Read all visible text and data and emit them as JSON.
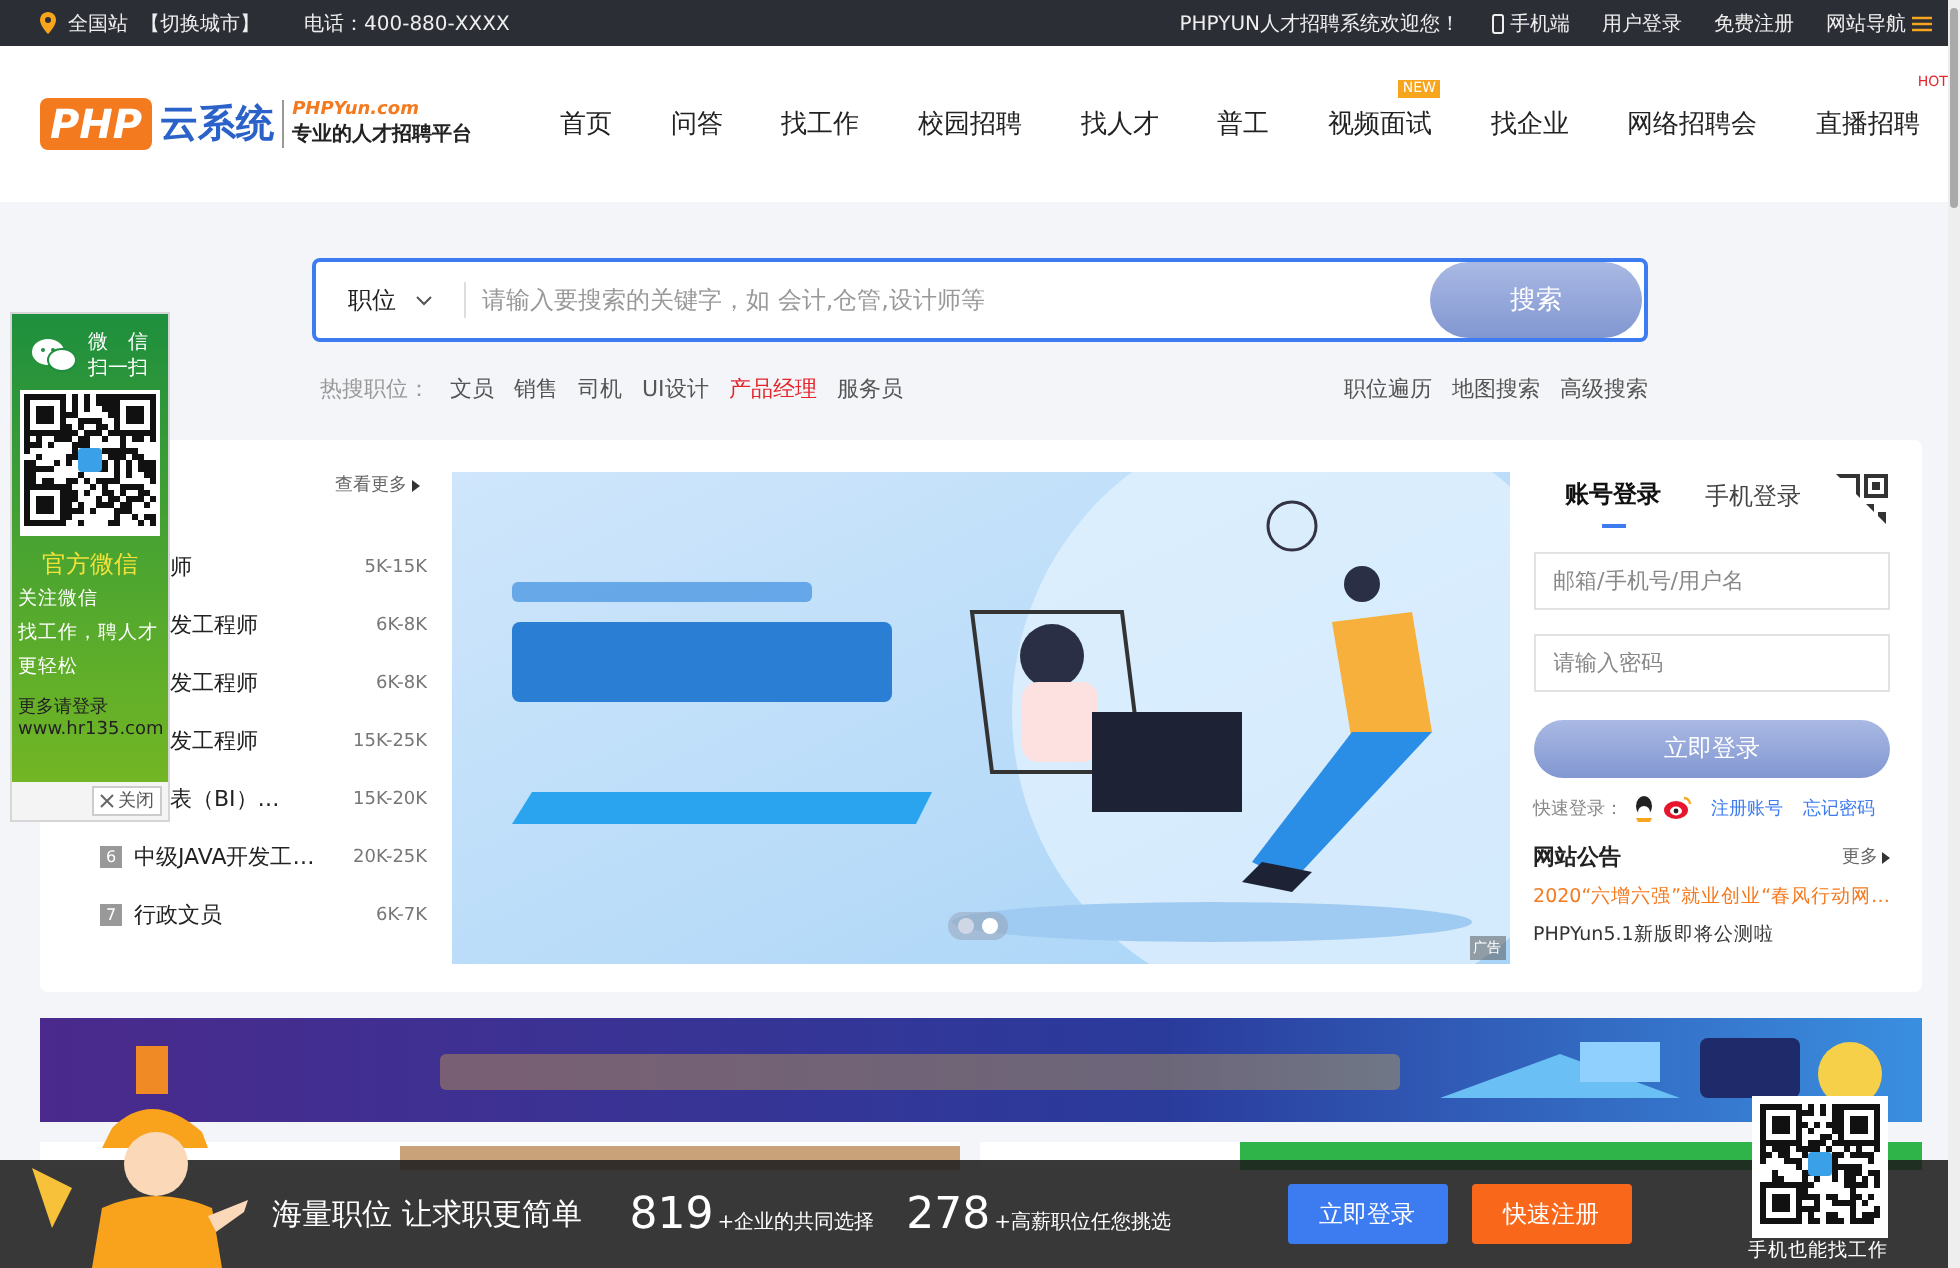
{
  "top_bar": {
    "location": "全国站",
    "switch_city": "【切换城市】",
    "phone": "电话：400-880-XXXX",
    "welcome": "PHPYUN人才招聘系统欢迎您！",
    "links": [
      {
        "label": "手机端",
        "kind": "mobile"
      },
      {
        "label": "用户登录",
        "kind": "plain"
      },
      {
        "label": "免费注册",
        "kind": "plain"
      },
      {
        "label": "网站导航",
        "kind": "menu"
      }
    ]
  },
  "logo": {
    "mark": "PHP",
    "name": "云系统",
    "domain": "PHPYun.com",
    "slogan": "专业的人才招聘平台"
  },
  "nav": [
    {
      "label": "首页"
    },
    {
      "label": "问答"
    },
    {
      "label": "找工作"
    },
    {
      "label": "校园招聘"
    },
    {
      "label": "找人才"
    },
    {
      "label": "普工"
    },
    {
      "label": "视频面试",
      "badge": "NEW",
      "kind": "new"
    },
    {
      "label": "找企业"
    },
    {
      "label": "网络招聘会"
    },
    {
      "label": "直播招聘",
      "badge": "HOT",
      "kind": "hot"
    }
  ],
  "search": {
    "category": "职位",
    "placeholder": "请输入要搜索的关键字，如 会计,仓管,设计师等",
    "button": "搜索"
  },
  "hot_search": {
    "label": "热搜职位：",
    "items": [
      {
        "label": "文员",
        "highlighted": false
      },
      {
        "label": "销售",
        "highlighted": false
      },
      {
        "label": "司机",
        "highlighted": false
      },
      {
        "label": "UI设计",
        "highlighted": false
      },
      {
        "label": "产品经理",
        "highlighted": true
      },
      {
        "label": "服务员",
        "highlighted": false
      }
    ],
    "links": [
      "职位遍历",
      "地图搜索",
      "高级搜索"
    ]
  },
  "jobs": {
    "more": "查看更多",
    "items": [
      {
        "title": "师",
        "salary": "5K-15K"
      },
      {
        "title": "发工程师",
        "salary": "6K-8K"
      },
      {
        "title": "发工程师",
        "salary": "6K-8K"
      },
      {
        "title": "发工程师",
        "salary": "15K-25K"
      },
      {
        "title": "表（BI）…",
        "salary": "15K-20K"
      },
      {
        "rank": "6",
        "title": "中级JAVA开发工…",
        "salary": "20K-25K"
      },
      {
        "rank": "7",
        "title": "行政文员",
        "salary": "6K-7K"
      }
    ]
  },
  "wechat_float": {
    "title_lines": [
      "微　信",
      "扫一扫"
    ],
    "heading": "官方微信",
    "lines": [
      "关注微信",
      "找工作，聘人才",
      "更轻松"
    ],
    "more": "更多请登录",
    "url": "www.hr135.com",
    "close": "关闭"
  },
  "banner": {
    "ad_label": "广告",
    "dots": [
      {
        "selected": false
      },
      {
        "selected": true
      }
    ]
  },
  "login": {
    "tabs": [
      {
        "label": "账号登录",
        "selected": true
      },
      {
        "label": "手机登录",
        "selected": false
      }
    ],
    "username_placeholder": "邮箱/手机号/用户名",
    "password_placeholder": "请输入密码",
    "button": "立即登录",
    "quick_label": "快速登录：",
    "links": [
      "注册账号",
      "忘记密码"
    ]
  },
  "notice": {
    "title": "网站公告",
    "more": "更多",
    "items": [
      {
        "text": "2020“六增六强”就业创业“春风行动网…",
        "highlighted": true
      },
      {
        "text": "PHPYun5.1新版即将公测啦",
        "highlighted": false
      }
    ]
  },
  "bottom_bar": {
    "slogan": "海量职位 让求职更简单",
    "stats": [
      {
        "number": "819",
        "label": "+企业的共同选择"
      },
      {
        "number": "278",
        "label": "+高薪职位任您挑选"
      }
    ],
    "buttons": [
      {
        "label": "立即登录",
        "kind": "primary"
      },
      {
        "label": "快速注册",
        "kind": "accent"
      }
    ],
    "qr_caption": "手机也能找工作"
  }
}
